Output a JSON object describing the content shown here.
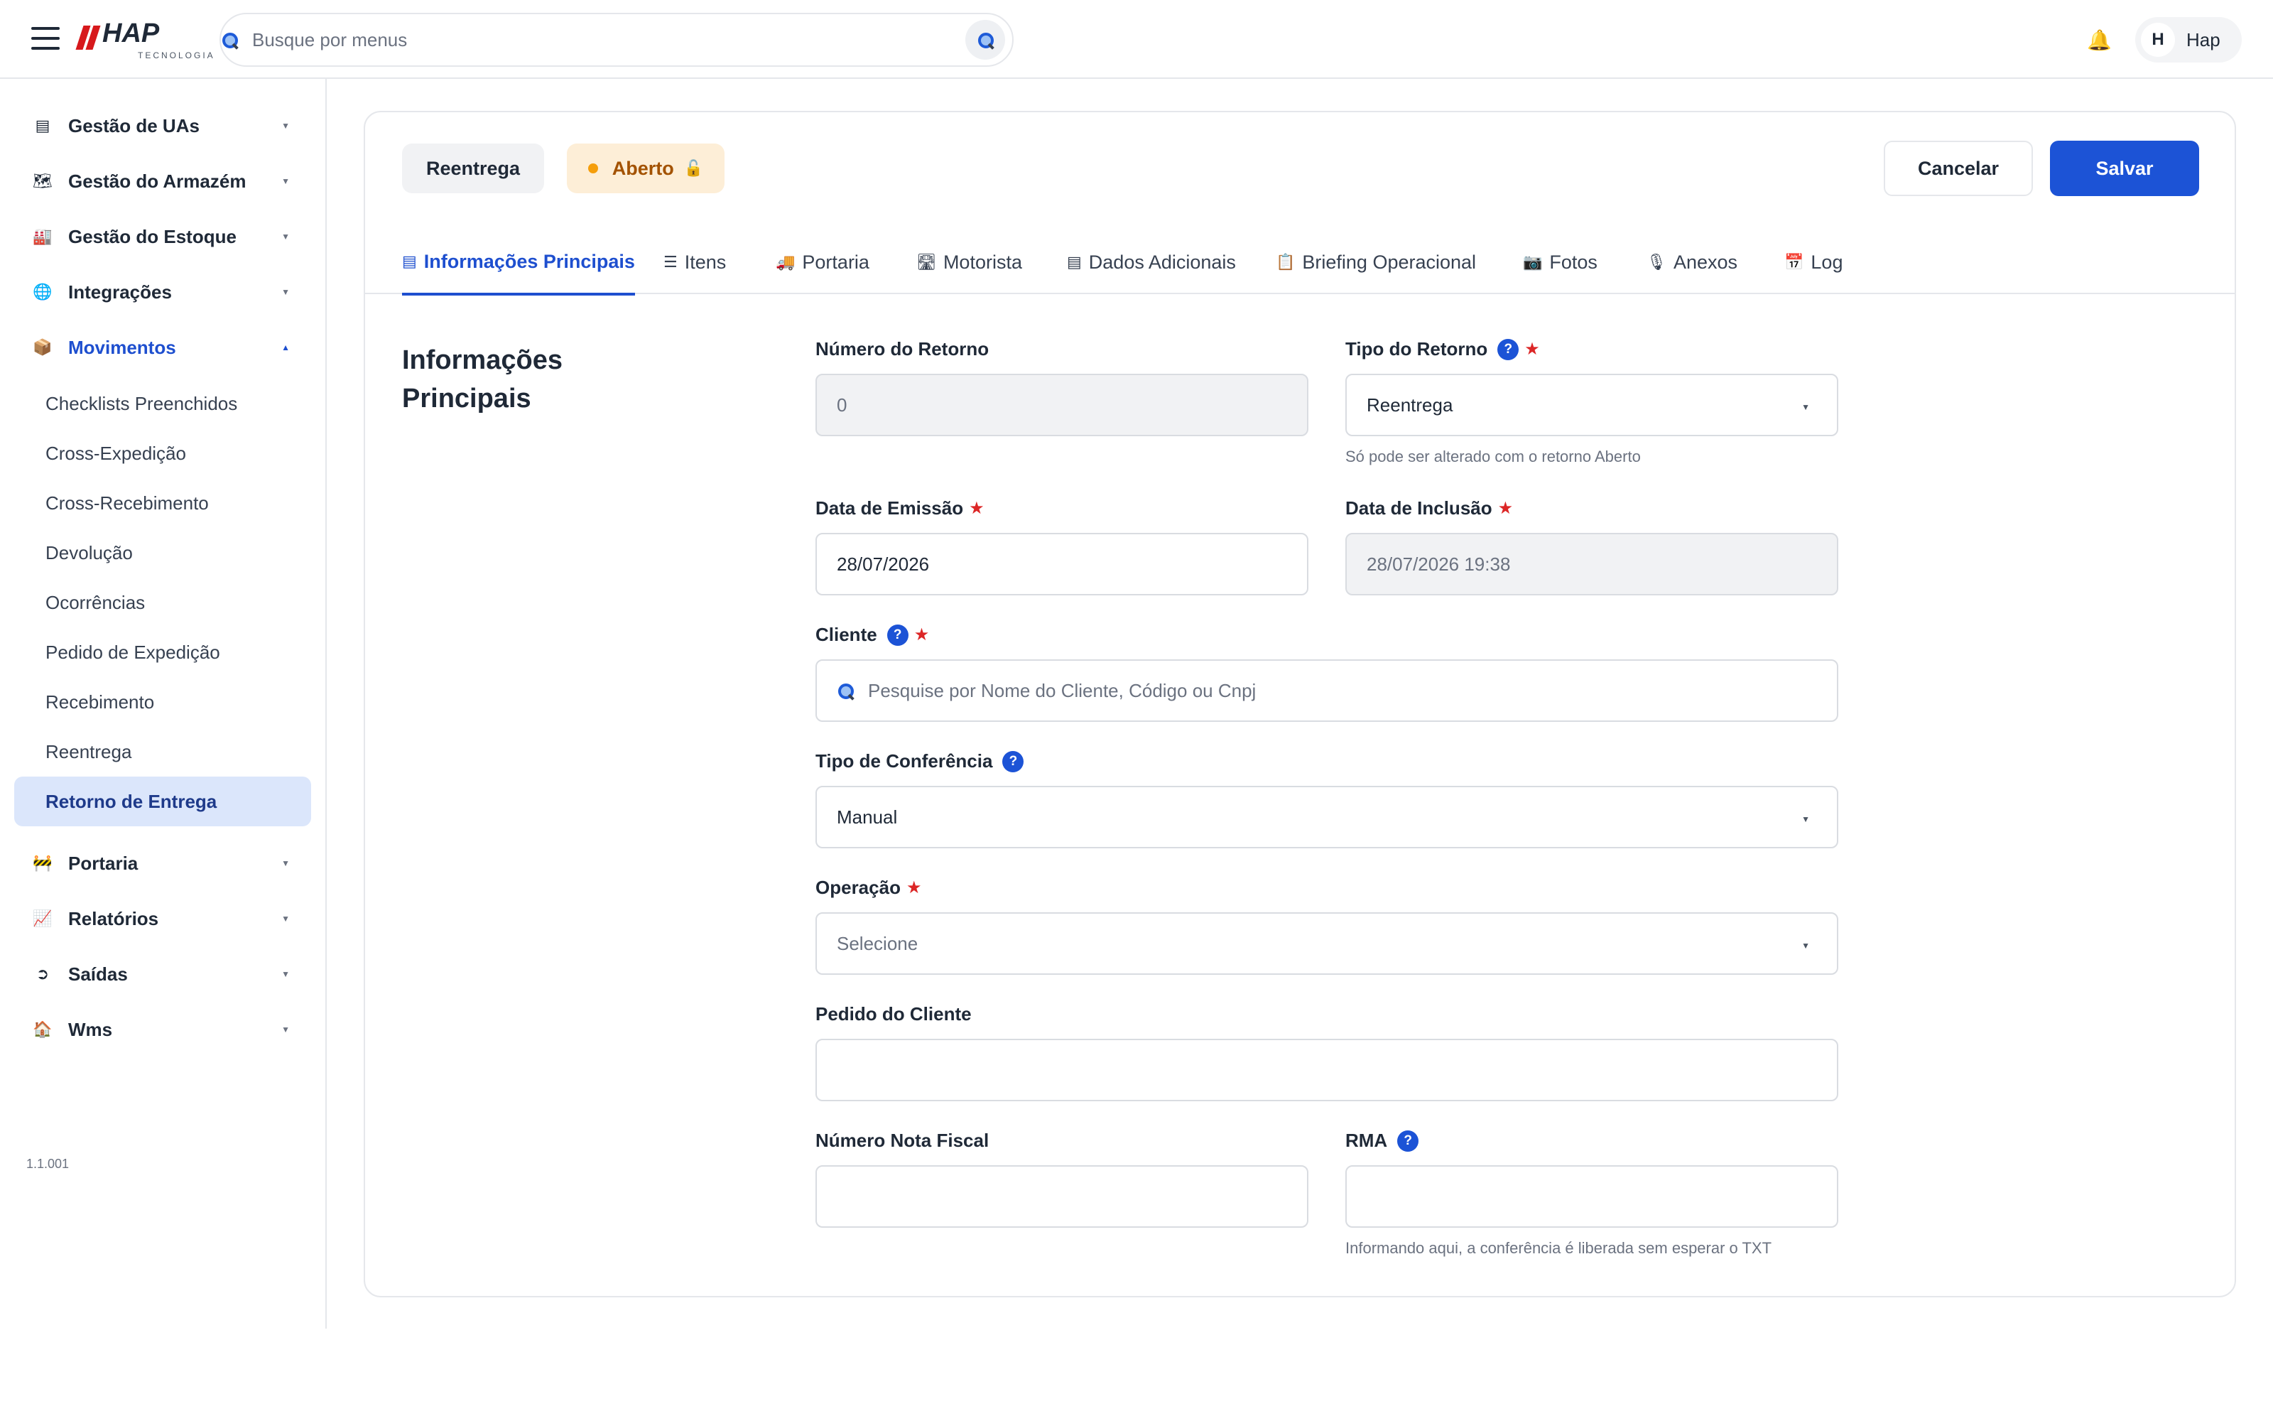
{
  "topbar": {
    "logo_text": "HAP",
    "logo_subtext": "TECNOLOGIA",
    "search_placeholder": "Busque por menus",
    "user_initial": "H",
    "user_name": "Hap"
  },
  "sidebar": {
    "items": [
      {
        "label": "Gestão de UAs",
        "icon": "▤"
      },
      {
        "label": "Gestão do Armazém",
        "icon": "🗺"
      },
      {
        "label": "Gestão do Estoque",
        "icon": "🏭"
      },
      {
        "label": "Integrações",
        "icon": "🌐"
      },
      {
        "label": "Movimentos",
        "icon": "📦"
      }
    ],
    "sub_items": [
      "Checklists Preenchidos",
      "Cross-Expedição",
      "Cross-Recebimento",
      "Devolução",
      "Ocorrências",
      "Pedido de Expedição",
      "Recebimento",
      "Reentrega",
      "Retorno de Entrega"
    ],
    "items_after": [
      {
        "label": "Portaria",
        "icon": "🚧"
      },
      {
        "label": "Relatórios",
        "icon": "📈"
      },
      {
        "label": "Saídas",
        "icon": "➲"
      },
      {
        "label": "Wms",
        "icon": "🏠"
      }
    ],
    "version": "1.1.001"
  },
  "header": {
    "type_chip": "Reentrega",
    "status_chip": "Aberto",
    "cancel_label": "Cancelar",
    "save_label": "Salvar"
  },
  "tabs": [
    {
      "label": "Informações Principais",
      "icon": "▤"
    },
    {
      "label": "Itens",
      "icon": "☰"
    },
    {
      "label": "Portaria",
      "icon": "🚚"
    },
    {
      "label": "Motorista",
      "icon": "🛣"
    },
    {
      "label": "Dados Adicionais",
      "icon": "▤"
    },
    {
      "label": "Briefing Operacional",
      "icon": "📋"
    },
    {
      "label": "Fotos",
      "icon": "📷"
    },
    {
      "label": "Anexos",
      "icon": "🎙"
    },
    {
      "label": "Log",
      "icon": "📅"
    }
  ],
  "form": {
    "section_title": "Informações Principais",
    "numero_retorno": {
      "label": "Número do Retorno",
      "value": "0"
    },
    "tipo_retorno": {
      "label": "Tipo do Retorno",
      "value": "Reentrega",
      "hint": "Só pode ser alterado com o retorno Aberto"
    },
    "data_emissao": {
      "label": "Data de Emissão",
      "value": "28/07/2026"
    },
    "data_inclusao": {
      "label": "Data de Inclusão",
      "value": "28/07/2026 19:38"
    },
    "cliente": {
      "label": "Cliente",
      "placeholder": "Pesquise por Nome do Cliente, Código ou Cnpj"
    },
    "tipo_conferencia": {
      "label": "Tipo de Conferência",
      "value": "Manual"
    },
    "operacao": {
      "label": "Operação",
      "placeholder": "Selecione"
    },
    "pedido_cliente": {
      "label": "Pedido do Cliente",
      "value": ""
    },
    "numero_nf": {
      "label": "Número Nota Fiscal",
      "value": ""
    },
    "rma": {
      "label": "RMA",
      "value": "",
      "hint": "Informando aqui, a conferência é liberada sem esperar o TXT"
    }
  },
  "colors": {
    "accent": "#1c53d6",
    "status_bg": "#fdeed7",
    "required": "#dc2626"
  }
}
